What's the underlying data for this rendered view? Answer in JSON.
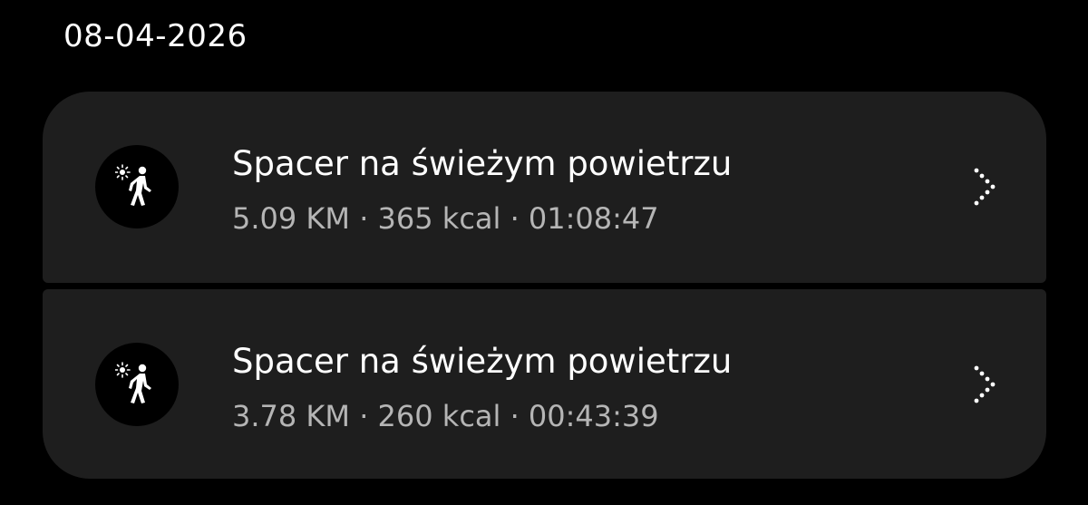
{
  "date_header": "08-04-2026",
  "colors": {
    "background": "#000000",
    "card": "#1e1e1e",
    "title_text": "#ffffff",
    "meta_text": "#b5b5b5"
  },
  "activities": [
    {
      "icon": "walk-outdoor-icon",
      "title": "Spacer na świeżym powietrzu",
      "meta": "5.09 KM · 365 kcal · 01:08:47"
    },
    {
      "icon": "walk-outdoor-icon",
      "title": "Spacer na świeżym powietrzu",
      "meta": "3.78 KM · 260 kcal · 00:43:39"
    }
  ]
}
